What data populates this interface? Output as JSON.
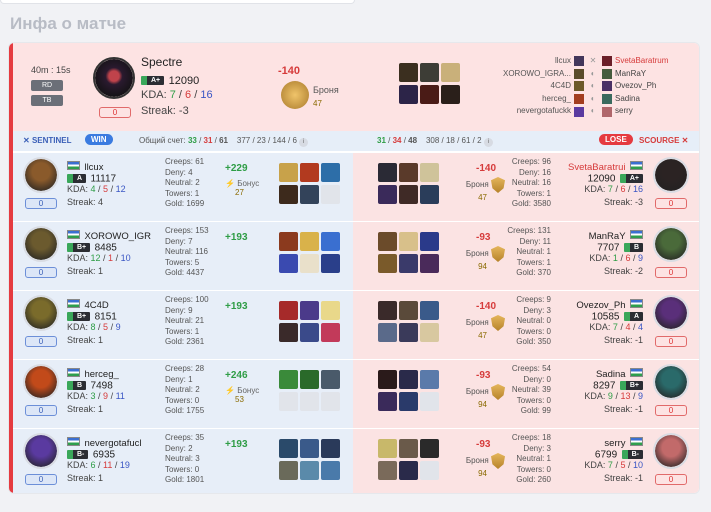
{
  "section_title": "Инфа о матче",
  "match": {
    "duration": "40m : 15s",
    "mode_1": "RD",
    "mode_2": "TB",
    "zero": "0",
    "mvp": {
      "name": "Spectre",
      "rating_badge": "A+",
      "mmr": "12090",
      "kda_label": "KDA:",
      "kills": "7",
      "deaths": "6",
      "assists": "16",
      "streak": "Streak: -3",
      "delta": "-140",
      "armor_label": "Броня",
      "armor_value": "47"
    },
    "header_players": [
      {
        "name": "llcux",
        "opponent": "SvetaBaratrum"
      },
      {
        "name": "XOROWO_IGRA...",
        "opponent": "ManRaY"
      },
      {
        "name": "4C4D",
        "opponent": "Ovezov_Ph"
      },
      {
        "name": "herceg_",
        "opponent": "Sadina"
      },
      {
        "name": "nevergotafuckk",
        "opponent": "serry"
      }
    ]
  },
  "teambar": {
    "sentinel": "SENTINEL",
    "win": "WIN",
    "total_label": "Общий счет:",
    "s_kills": "33",
    "s_deaths": "31",
    "s_assists": "61",
    "s_extra": "377 / 23 / 144 / 6",
    "r_kills": "31",
    "r_deaths": "34",
    "r_assists": "48",
    "r_extra": "308 / 18 / 61 / 2",
    "lose": "LOSE",
    "scourge": "SCOURGE"
  },
  "rows": [
    {
      "l": {
        "name": "llcux",
        "badge": "A",
        "mmr": "11117",
        "kills": "4",
        "deaths": "5",
        "assists": "12",
        "streak": "Streak: 4",
        "creeps": "Creeps: 61",
        "deny": "Deny: 4",
        "neutral": "Neutral: 2",
        "towers": "Towers: 1",
        "gold": "Gold: 1699",
        "delta": "+229",
        "bonus": "Бонус",
        "bonus_value": "27",
        "zero": "0"
      },
      "r": {
        "name": "SvetaBaratrui",
        "badge": "A+",
        "mmr": "12090",
        "kills": "7",
        "deaths": "6",
        "assists": "16",
        "streak": "Streak: -3",
        "creeps": "Creeps: 96",
        "deny": "Deny: 16",
        "neutral": "Neutral: 16",
        "towers": "Towers: 1",
        "gold": "Gold: 3580",
        "delta": "-140",
        "armor": "Броня",
        "armor_value": "47",
        "zero": "0"
      }
    },
    {
      "l": {
        "name": "XOROWO_IGR",
        "badge": "B+",
        "mmr": "8485",
        "kills": "12",
        "deaths": "1",
        "assists": "10",
        "streak": "Streak: 1",
        "creeps": "Creeps: 153",
        "deny": "Deny: 7",
        "neutral": "Neutral: 116",
        "towers": "Towers: 5",
        "gold": "Gold: 4437",
        "delta": "+193",
        "zero": "0"
      },
      "r": {
        "name": "ManRaY",
        "badge": "B",
        "mmr": "7707",
        "kills": "1",
        "deaths": "6",
        "assists": "9",
        "streak": "Streak: -2",
        "creeps": "Creeps: 131",
        "deny": "Deny: 11",
        "neutral": "Neutral: 1",
        "towers": "Towers: 1",
        "gold": "Gold: 370",
        "delta": "-93",
        "armor": "Броня",
        "armor_value": "94",
        "zero": "0"
      }
    },
    {
      "l": {
        "name": "4C4D",
        "badge": "B+",
        "mmr": "8151",
        "kills": "8",
        "deaths": "5",
        "assists": "9",
        "streak": "Streak: 1",
        "creeps": "Creeps: 100",
        "deny": "Deny: 9",
        "neutral": "Neutral: 21",
        "towers": "Towers: 1",
        "gold": "Gold: 2361",
        "delta": "+193",
        "zero": "0"
      },
      "r": {
        "name": "Ovezov_Ph",
        "badge": "A",
        "mmr": "10585",
        "kills": "7",
        "deaths": "4",
        "assists": "4",
        "streak": "Streak: -1",
        "creeps": "Creeps: 9",
        "deny": "Deny: 3",
        "neutral": "Neutral: 0",
        "towers": "Towers: 0",
        "gold": "Gold: 350",
        "delta": "-140",
        "armor": "Броня",
        "armor_value": "47",
        "zero": "0"
      }
    },
    {
      "l": {
        "name": "herceg_",
        "badge": "B",
        "mmr": "7498",
        "kills": "3",
        "deaths": "9",
        "assists": "11",
        "streak": "Streak: 1",
        "creeps": "Creeps: 28",
        "deny": "Deny: 1",
        "neutral": "Neutral: 2",
        "towers": "Towers: 0",
        "gold": "Gold: 1755",
        "delta": "+246",
        "bonus": "Бонус",
        "bonus_value": "53",
        "zero": "0"
      },
      "r": {
        "name": "Sadina",
        "badge": "B+",
        "mmr": "8297",
        "kills": "9",
        "deaths": "13",
        "assists": "9",
        "streak": "Streak: -1",
        "creeps": "Creeps: 54",
        "deny": "Deny: 0",
        "neutral": "Neutral: 39",
        "towers": "Towers: 0",
        "gold": "Gold: 99",
        "delta": "-93",
        "armor": "Броня",
        "armor_value": "94",
        "zero": "0"
      }
    },
    {
      "l": {
        "name": "nevergotafucl",
        "badge": "B-",
        "mmr": "6935",
        "kills": "6",
        "deaths": "11",
        "assists": "19",
        "streak": "Streak: 1",
        "creeps": "Creeps: 35",
        "deny": "Deny: 2",
        "neutral": "Neutral: 3",
        "towers": "Towers: 0",
        "gold": "Gold: 1801",
        "delta": "+193",
        "zero": "0"
      },
      "r": {
        "name": "serry",
        "badge": "B-",
        "mmr": "6799",
        "kills": "7",
        "deaths": "5",
        "assists": "10",
        "streak": "Streak: -1",
        "creeps": "Creeps: 18",
        "deny": "Deny: 3",
        "neutral": "Neutral: 1",
        "towers": "Towers: 0",
        "gold": "Gold: 260",
        "delta": "-93",
        "armor": "Броня",
        "armor_value": "94",
        "zero": "0"
      }
    }
  ],
  "colors": {
    "win": "#3a7be0",
    "lose": "#e53b40",
    "positive": "#2f9d46",
    "negative": "#d63b3b"
  }
}
